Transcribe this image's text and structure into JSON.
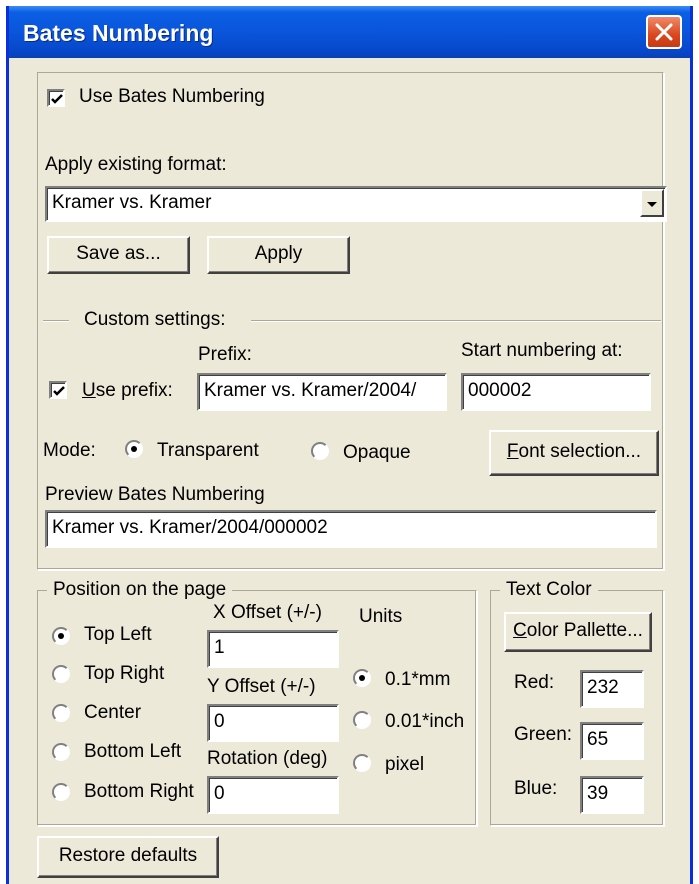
{
  "window": {
    "title": "Bates Numbering"
  },
  "use_bates": {
    "label": "Use Bates Numbering",
    "checked": true
  },
  "format": {
    "label": "Apply existing format:",
    "selected": "Kramer vs. Kramer",
    "save_as_label": "Save as...",
    "apply_label": "Apply"
  },
  "custom": {
    "legend": "Custom settings:",
    "prefix_header": "Prefix:",
    "use_prefix_u": "U",
    "use_prefix_rest": "se prefix:",
    "use_prefix_checked": true,
    "prefix_value": "Kramer vs. Kramer/2004/",
    "start_label": "Start numbering at:",
    "start_value": "000002",
    "mode_label": "Mode:",
    "mode_transparent": "Transparent",
    "mode_opaque": "Opaque",
    "mode_selected": "Transparent",
    "font_btn_u": "F",
    "font_btn_rest": "ont selection...",
    "preview_label": "Preview Bates Numbering",
    "preview_value": "Kramer vs. Kramer/2004/000002"
  },
  "position": {
    "legend": "Position on the page",
    "options": [
      "Top Left",
      "Top Right",
      "Center",
      "Bottom Left",
      "Bottom Right"
    ],
    "selected": "Top Left",
    "x_label": "X Offset (+/-)",
    "x_value": "1",
    "y_label": "Y Offset (+/-)",
    "y_value": "0",
    "rot_label": "Rotation (deg)",
    "rot_value": "0",
    "units_label": "Units",
    "unit_options": [
      "0.1*mm",
      "0.01*inch",
      "pixel"
    ],
    "unit_selected": "0.1*mm"
  },
  "text_color": {
    "legend": "Text Color",
    "palette_u": "C",
    "palette_rest": "olor Pallette...",
    "red_label": "Red:",
    "red_value": "232",
    "green_label": "Green:",
    "green_value": "65",
    "blue_label": "Blue:",
    "blue_value": "39"
  },
  "restore_label": "Restore defaults",
  "icons": {
    "close": "close-icon",
    "check": "checkmark-icon",
    "dropdown": "chevron-down-icon"
  },
  "colors": {
    "titlebar": "#0a55db",
    "close_button": "#d9481f",
    "dialog_bg": "#ece9d8"
  }
}
